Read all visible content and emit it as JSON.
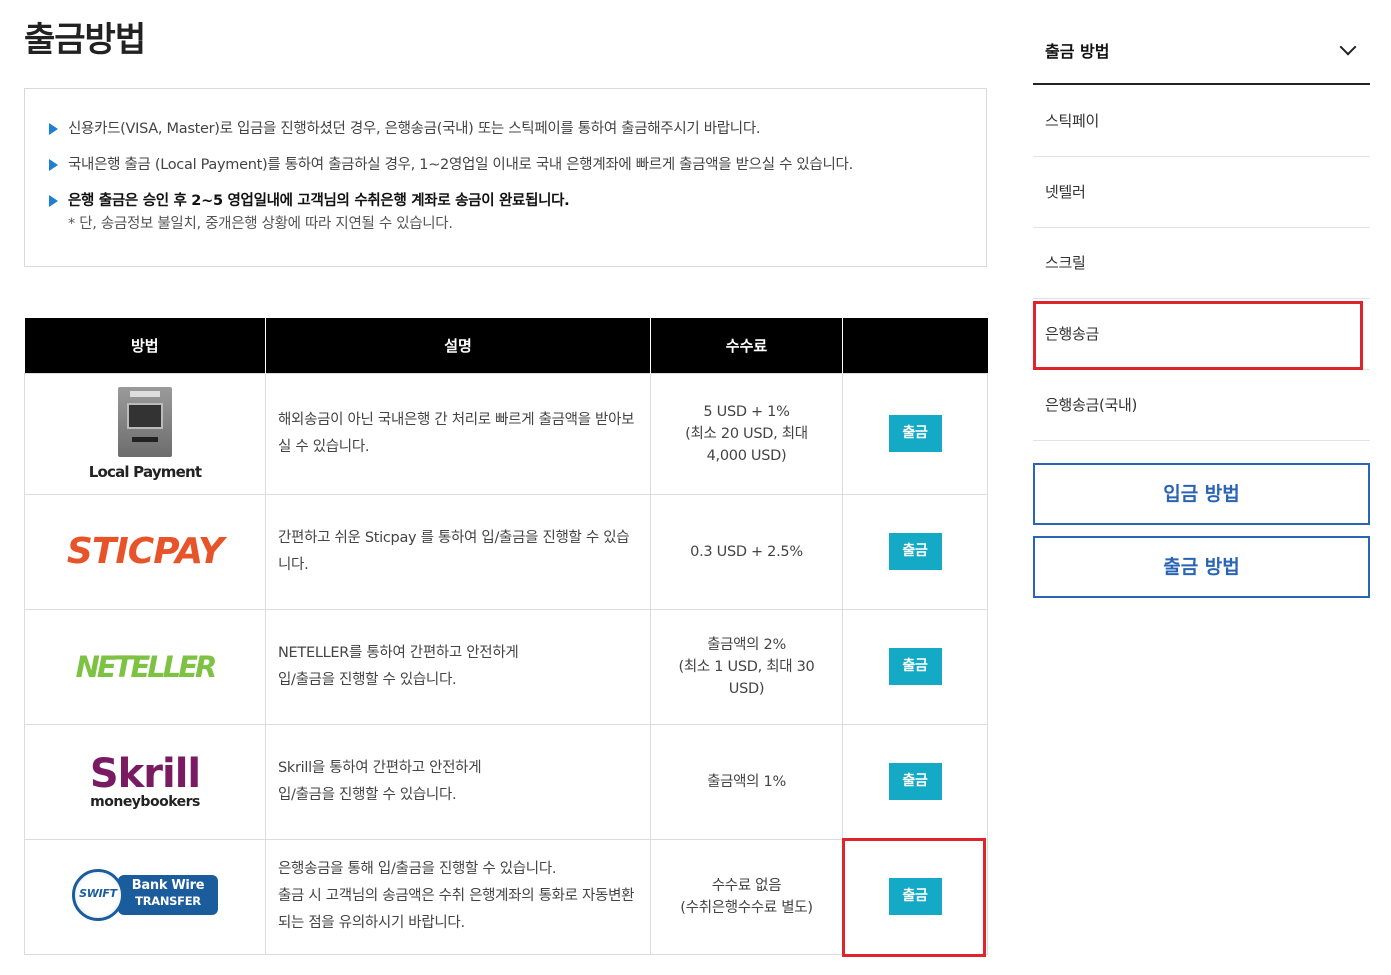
{
  "page": {
    "title": "출금방법"
  },
  "notice": {
    "items": [
      {
        "text": "신용카드(VISA, Master)로 입금을 진행하셨던 경우, 은행송금(국내) 또는 스틱페이를 통하여 출금해주시기 바랍니다."
      },
      {
        "text": "국내은행 출금 (Local Payment)를 통하여 출금하실 경우, 1~2영업일 이내로 국내 은행계좌에 빠르게 출금액을 받으실 수 있습니다."
      },
      {
        "text": "은행 출금은 승인 후 2~5 영업일내에 고객님의 수취은행 계좌로 송금이 완료됩니다.",
        "sub": "* 단, 송금정보 불일치, 중개은행 상황에 따라 지연될 수 있습니다."
      }
    ]
  },
  "table": {
    "headers": [
      "방법",
      "설명",
      "수수료",
      ""
    ],
    "button_label": "출금",
    "rows": [
      {
        "logo": "atm-icon",
        "logo_caption": "Local Payment",
        "description": "해외송금이 아닌 국내은행 간 처리로 빠르게 출금액을 받아보실 수 있습니다.",
        "fee_lines": [
          "5 USD + 1%",
          "(최소 20 USD, 최대",
          "4,000 USD)"
        ]
      },
      {
        "logo": "sticpay-logo",
        "logo_text": "STICPAY",
        "description": "간편하고 쉬운 Sticpay 를 통하여 입/출금을 진행할 수 있습니다.",
        "fee_lines": [
          "0.3 USD + 2.5%"
        ]
      },
      {
        "logo": "neteller-logo",
        "logo_text": "NETELLER",
        "description_lines": [
          "NETELLER를 통하여 간편하고 안전하게",
          "입/출금을 진행할 수 있습니다."
        ],
        "fee_lines": [
          "출금액의 2%",
          "(최소 1 USD, 최대 30",
          "USD)"
        ]
      },
      {
        "logo": "skrill-logo",
        "logo_text": "Skrill",
        "logo_sub": "moneybookers",
        "description_lines": [
          "Skrill을 통하여 간편하고 안전하게",
          "입/출금을 진행할 수 있습니다."
        ],
        "fee_lines": [
          "출금액의 1%"
        ]
      },
      {
        "logo": "swift-bank-wire-logo",
        "swift_text": "SWIFT",
        "badge_line1": "Bank Wire",
        "badge_line2": "TRANSFER",
        "description_lines": [
          "은행송금을 통해 입/출금을 진행할 수 있습니다.",
          "출금 시 고객님의 송금액은 수취 은행계좌의 통화로 자동변환되는 점을 유의하시기 바랍니다."
        ],
        "fee_lines": [
          "수수료 없음",
          "(수취은행수수료 별도)"
        ]
      }
    ]
  },
  "sidebar": {
    "title": "출금 방법",
    "items": [
      "스틱페이",
      "넷텔러",
      "스크릴",
      "은행송금",
      "은행송금(국내)"
    ],
    "buttons": [
      "입금 방법",
      "출금 방법"
    ]
  },
  "colors": {
    "accent_button": "#14a9c4",
    "highlight_box": "#e0242b",
    "sidebar_button": "#2a64b4",
    "bullet": "#1f7fd1"
  }
}
